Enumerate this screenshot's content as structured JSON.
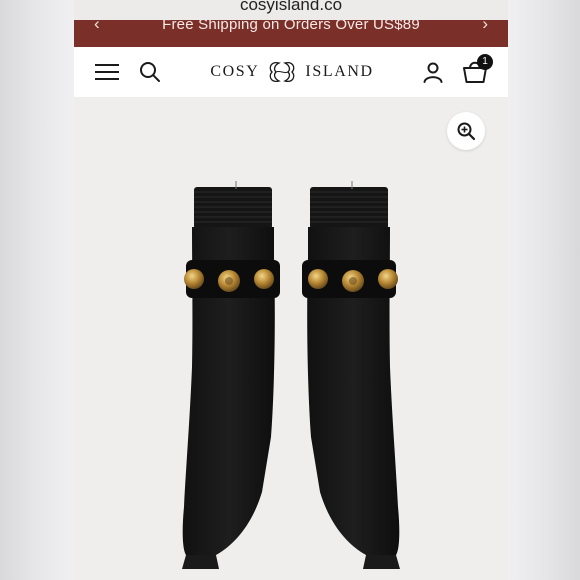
{
  "browser": {
    "url": "cosyisland.co"
  },
  "promo_bar": {
    "text": "Free Shipping on Orders Over US$89",
    "prev_icon": "chevron-left-icon",
    "next_icon": "chevron-right-icon"
  },
  "header": {
    "logo_left": "COSY",
    "logo_right": "ISLAND",
    "menu_icon": "hamburger-menu-icon",
    "search_icon": "search-icon",
    "account_icon": "account-icon",
    "cart_icon": "cart-icon",
    "cart_count": "1"
  },
  "product": {
    "zoom_icon": "zoom-in-icon",
    "image": "black-knit-sock-ankle-boots-with-gold-studded-strap"
  },
  "colors": {
    "promo_background": "#7a2f29",
    "header_background": "#ffffff",
    "page_background": "#efeeed",
    "text_dark": "#1a1a1a"
  }
}
